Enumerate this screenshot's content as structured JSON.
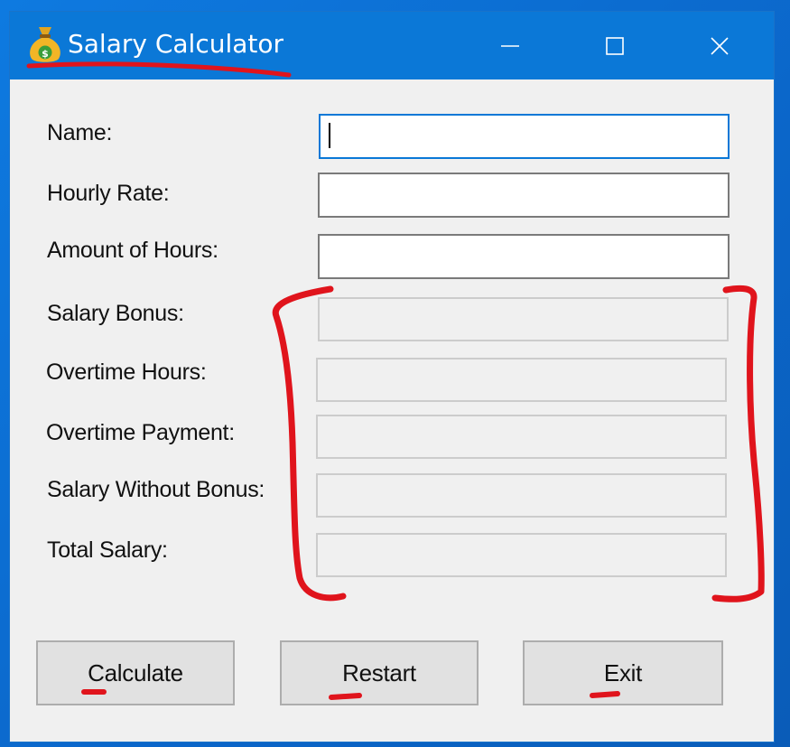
{
  "window": {
    "title": "Salary Calculator",
    "app_icon": "money-bag-icon"
  },
  "title_controls": [
    "minimize-icon",
    "maximize-icon",
    "close-icon"
  ],
  "form": {
    "name_label": "Name:",
    "name_value": "",
    "hourly_rate_label": "Hourly Rate:",
    "hourly_rate_value": "",
    "hours_label": "Amount of Hours:",
    "hours_value": "",
    "salary_bonus_label": "Salary Bonus:",
    "salary_bonus_value": "",
    "overtime_hours_label": "Overtime Hours:",
    "overtime_hours_value": "",
    "overtime_payment_label": "Overtime Payment:",
    "overtime_payment_value": "",
    "salary_without_bonus_label": "Salary Without Bonus:",
    "salary_without_bonus_value": "",
    "total_salary_label": "Total Salary:",
    "total_salary_value": ""
  },
  "buttons": {
    "calculate_first": "C",
    "calculate_rest": "alculate",
    "restart_first": "R",
    "restart_rest": "estart",
    "exit_first": "E",
    "exit_rest": "xit"
  },
  "colors": {
    "titlebar": "#0b78d7",
    "window_bg": "#f0f0f0",
    "annotation": "#e0141c",
    "focus_border": "#0a78d7"
  }
}
